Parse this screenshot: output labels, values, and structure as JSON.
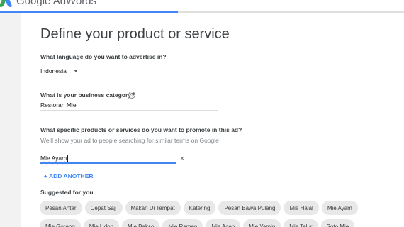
{
  "app": {
    "name": "Google AdWords"
  },
  "progress": {
    "fraction": 0.44,
    "color": "#4285f4"
  },
  "page": {
    "title": "Define your product or service"
  },
  "language": {
    "label": "What language do you want to advertise in?",
    "selected": "Indonesia"
  },
  "category": {
    "label": "What is your business category?",
    "value": "Restoran Mie",
    "help_icon": "?"
  },
  "products": {
    "label": "What specific products or services do you want to promote in this ad?",
    "hint": "We'll show your ad to people searching for similar terms on Google",
    "input_word1": "Mie",
    "input_word2": "Ayam",
    "clear_icon": "×",
    "add_label": "+ ADD ANOTHER"
  },
  "suggested": {
    "label": "Suggested for you",
    "chips": [
      "Pesan Antar",
      "Cepat Saji",
      "Makan Di Tempat",
      "Katering",
      "Pesan Bawa Pulang",
      "Mie Halal",
      "Mie Ayam",
      "Mie Goreng",
      "Mie Udon",
      "Mie Bakso",
      "Mie Ramen",
      "Mie Aceh",
      "Mie Yamin",
      "Mie Telur",
      "Soto Mie"
    ]
  },
  "colors": {
    "accent": "#4285f4",
    "background": "#f2f2f2",
    "chip": "#e8e8e8"
  },
  "icons": [
    "adwords-logo-icon",
    "dropdown-caret-icon",
    "help-icon",
    "close-icon"
  ]
}
